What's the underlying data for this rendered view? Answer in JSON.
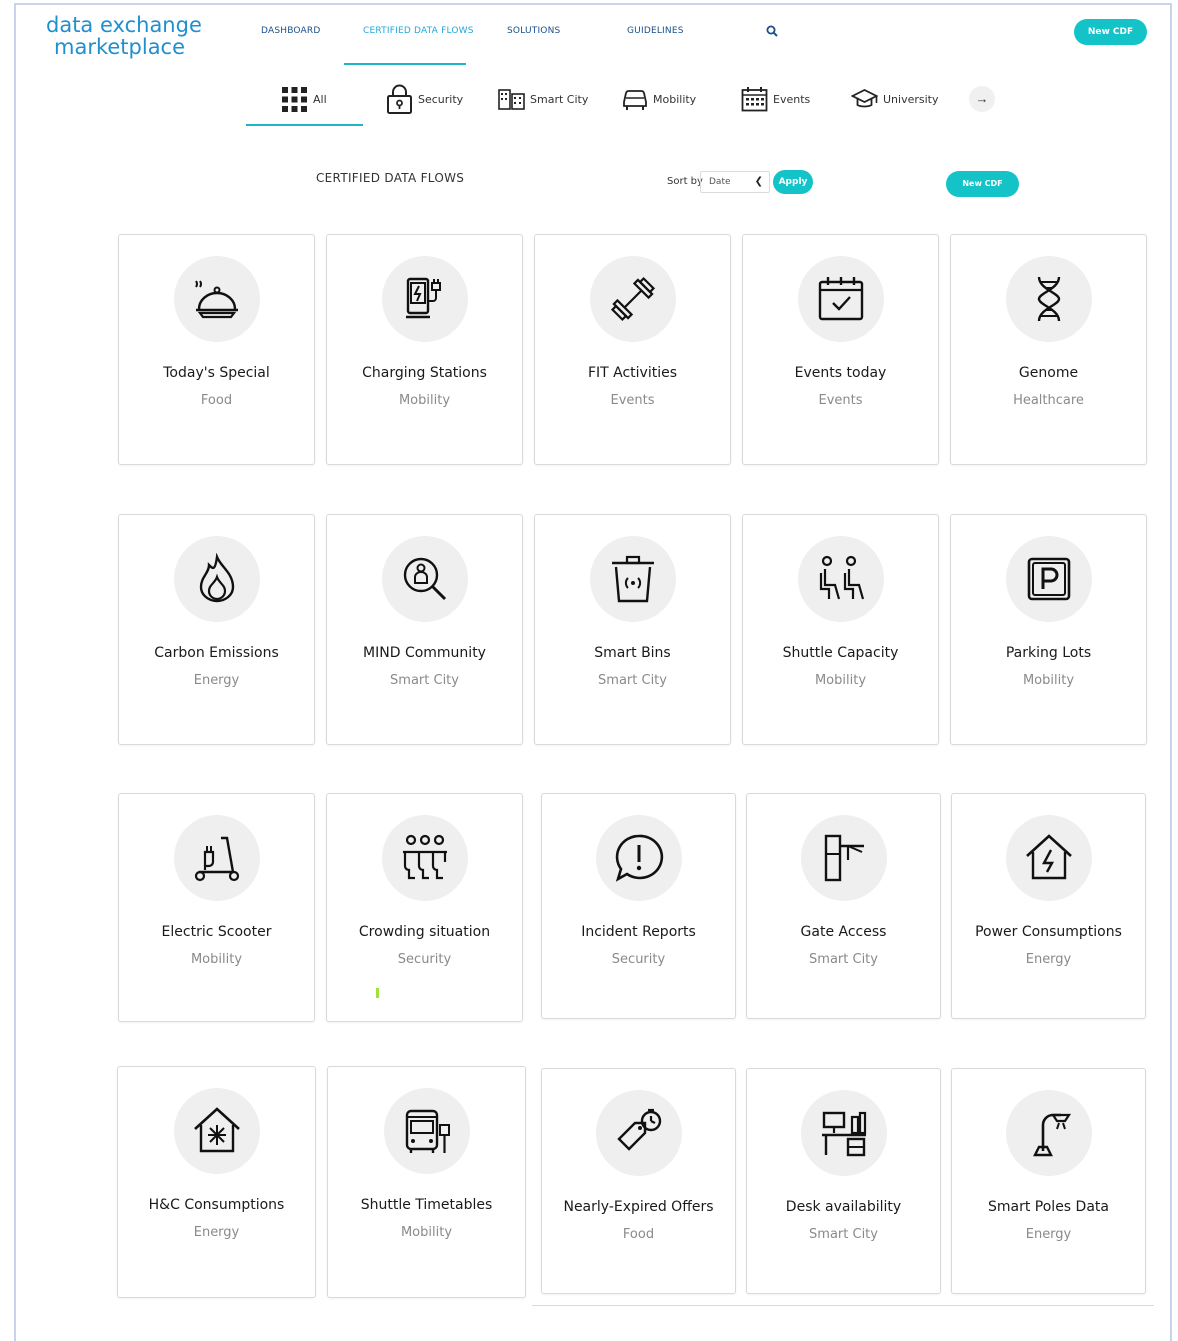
{
  "header": {
    "logo_line1": "data exchange",
    "logo_line2": "marketplace",
    "nav": [
      "DASHBOARD",
      "CERTIFIED DATA FLOWS",
      "SOLUTIONS",
      "GUIDELINES"
    ],
    "new_cdf_label": "New CDF"
  },
  "categories": [
    "All",
    "Security",
    "Smart City",
    "Mobility",
    "Events",
    "University"
  ],
  "toolbar": {
    "section_title": "CERTIFIED DATA FLOWS",
    "sort_label": "Sort by",
    "sort_value": "Date",
    "apply_label": "Apply",
    "new_cdf_label": "New CDF"
  },
  "cards": [
    {
      "title": "Today's Special",
      "category": "Food",
      "icon": "food-cloche-icon"
    },
    {
      "title": "Charging Stations",
      "category": "Mobility",
      "icon": "charging-station-icon"
    },
    {
      "title": "FIT Activities",
      "category": "Events",
      "icon": "dumbbell-icon"
    },
    {
      "title": "Events today",
      "category": "Events",
      "icon": "calendar-check-icon"
    },
    {
      "title": "Genome",
      "category": "Healthcare",
      "icon": "dna-icon"
    },
    {
      "title": "Carbon Emissions",
      "category": "Energy",
      "icon": "flame-icon"
    },
    {
      "title": "MIND Community",
      "category": "Smart City",
      "icon": "person-search-icon"
    },
    {
      "title": "Smart Bins",
      "category": "Smart City",
      "icon": "smart-bin-icon"
    },
    {
      "title": "Shuttle Capacity",
      "category": "Mobility",
      "icon": "seated-people-icon"
    },
    {
      "title": "Parking Lots",
      "category": "Mobility",
      "icon": "parking-icon"
    },
    {
      "title": "Electric Scooter",
      "category": "Mobility",
      "icon": "electric-scooter-icon"
    },
    {
      "title": "Crowding situation",
      "category": "Security",
      "icon": "crowd-icon"
    },
    {
      "title": "Incident Reports",
      "category": "Security",
      "icon": "alert-message-icon"
    },
    {
      "title": "Gate Access",
      "category": "Smart City",
      "icon": "gate-barrier-icon"
    },
    {
      "title": "Power Consumptions",
      "category": "Energy",
      "icon": "home-power-icon"
    },
    {
      "title": "H&C Consumptions",
      "category": "Energy",
      "icon": "home-climate-icon"
    },
    {
      "title": "Shuttle Timetables",
      "category": "Mobility",
      "icon": "bus-stop-icon"
    },
    {
      "title": "Nearly-Expired Offers",
      "category": "Food",
      "icon": "tag-timer-icon"
    },
    {
      "title": "Desk availability",
      "category": "Smart City",
      "icon": "desk-icon"
    },
    {
      "title": "Smart Poles Data",
      "category": "Energy",
      "icon": "street-light-icon"
    }
  ]
}
